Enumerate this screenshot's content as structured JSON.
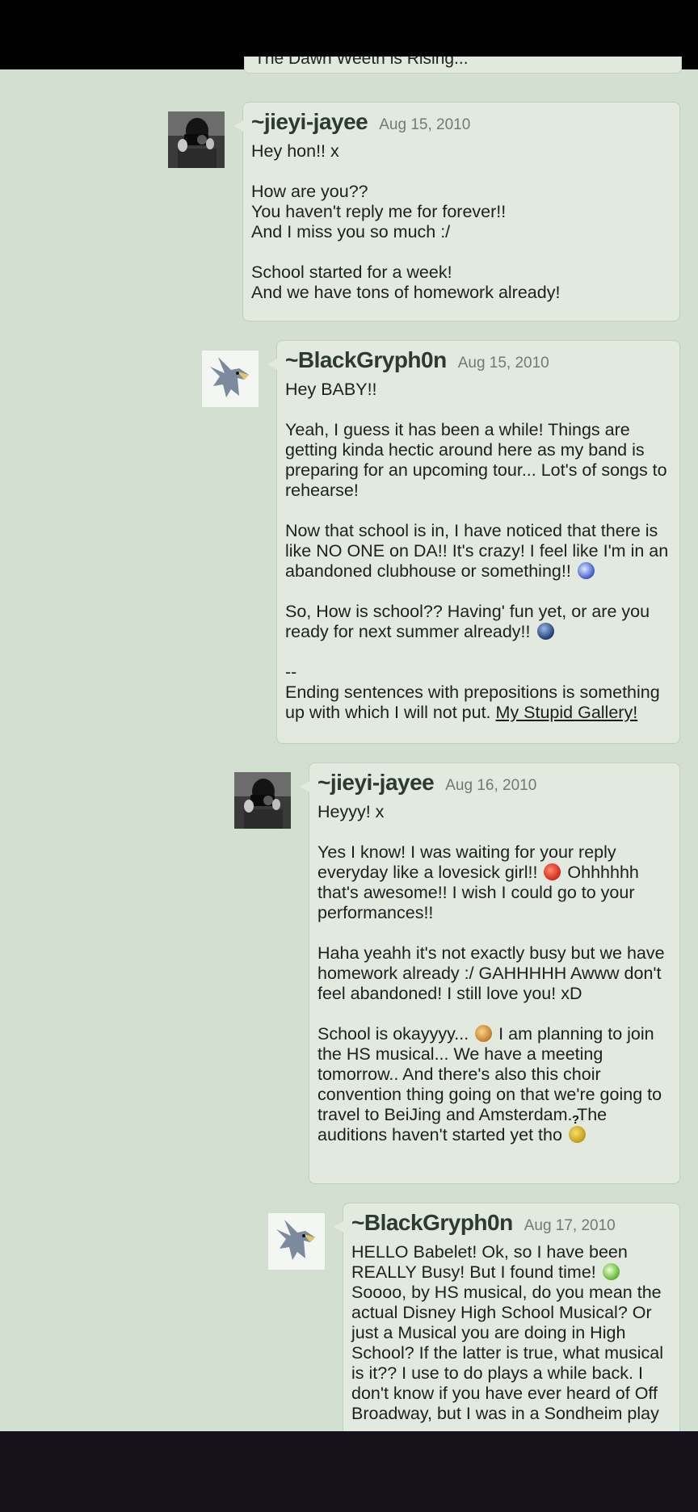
{
  "partial_comment": {
    "text": "The Dawn Weeth is Rising..."
  },
  "comments": [
    {
      "username": "~jieyi-jayee",
      "date": "Aug 15, 2010",
      "paragraphs": [
        [
          "Hey hon!! x"
        ],
        [
          "How are you??",
          "You haven't reply me for forever!!",
          "And I miss you so much :/"
        ],
        [
          "School started for a week!",
          "And we have tons of homework already!"
        ]
      ]
    },
    {
      "username": "~BlackGryph0n",
      "date": "Aug 15, 2010",
      "p1": "Hey BABY!!",
      "p2": "Yeah, I guess it has been a while! Things are getting kinda hectic around here as my band is preparing for an upcoming tour... Lot's of songs to rehearse!",
      "p3": "Now that school is in, I have noticed that there is like NO ONE on DA!! It's crazy! I feel like I'm in an abandoned clubhouse or something!!",
      "p4": "So, How is school?? Having' fun yet, or are you ready for next summer already!!",
      "sig_dash": "--",
      "sig_text": "Ending sentences with prepositions is something up with which I will not put.",
      "sig_link": "My Stupid Gallery!"
    },
    {
      "username": "~jieyi-jayee",
      "date": "Aug 16, 2010",
      "p1": "Heyyy! x",
      "p2a": "Yes I know! I was waiting for your reply everyday like a lovesick girl!!",
      "p2b": "Ohhhhhh that's awesome!! I wish I could go to your performances!!",
      "p3": "Haha yeahh it's not exactly busy but we have homework already :/ GAHHHHH Awww don't feel abandoned! I still love you! xD",
      "p4a": "School is okayyyy...",
      "p4b": "I am planning to join the HS musical... We have a meeting tomorrow.. And there's also this choir convention thing going on that we're going to travel to BeiJing and Amsterdam. The auditions haven't started yet tho",
      "emoticon_mark": "?"
    },
    {
      "username": "~BlackGryph0n",
      "date": "Aug 17, 2010",
      "p1a": "HELLO Babelet! Ok, so I have been REALLY Busy! But I found time!",
      "p1b": "Soooo, by HS musical, do you mean the actual Disney High School Musical? Or just a Musical you are doing in High School? If the latter is true, what musical is it?? I use to do plays a while back. I don't know if you have ever heard of Off Broadway, but I was in a Sondheim play"
    }
  ]
}
